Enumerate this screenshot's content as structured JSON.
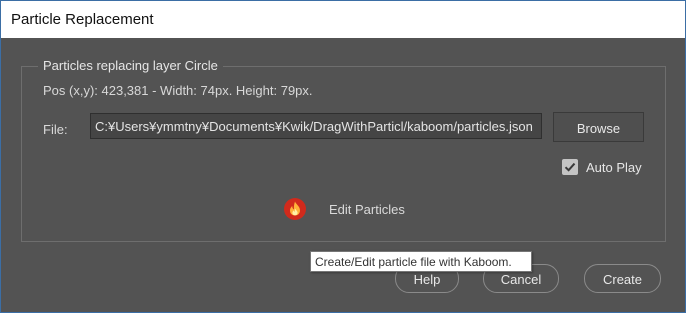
{
  "window": {
    "title": "Particle Replacement"
  },
  "group": {
    "legend": "Particles replacing layer Circle",
    "position_text": "Pos (x,y): 423,381 - Width: 74px. Height: 79px."
  },
  "file": {
    "label": "File:",
    "value": "C:¥Users¥ymmtny¥Documents¥Kwik/DragWithParticl/kaboom/particles.json"
  },
  "buttons": {
    "browse": "Browse",
    "help": "Help",
    "cancel": "Cancel",
    "create": "Create"
  },
  "auto_play": {
    "label": "Auto Play",
    "checked": true
  },
  "edit_particles": {
    "label": "Edit Particles",
    "icon": "flame-icon"
  },
  "tooltip": {
    "text": "Create/Edit particle file with Kaboom."
  },
  "colors": {
    "background": "#535353",
    "titlebar": "#ffffff",
    "flame_badge": "#d12a1c",
    "tooltip_bg": "#ffffff"
  }
}
